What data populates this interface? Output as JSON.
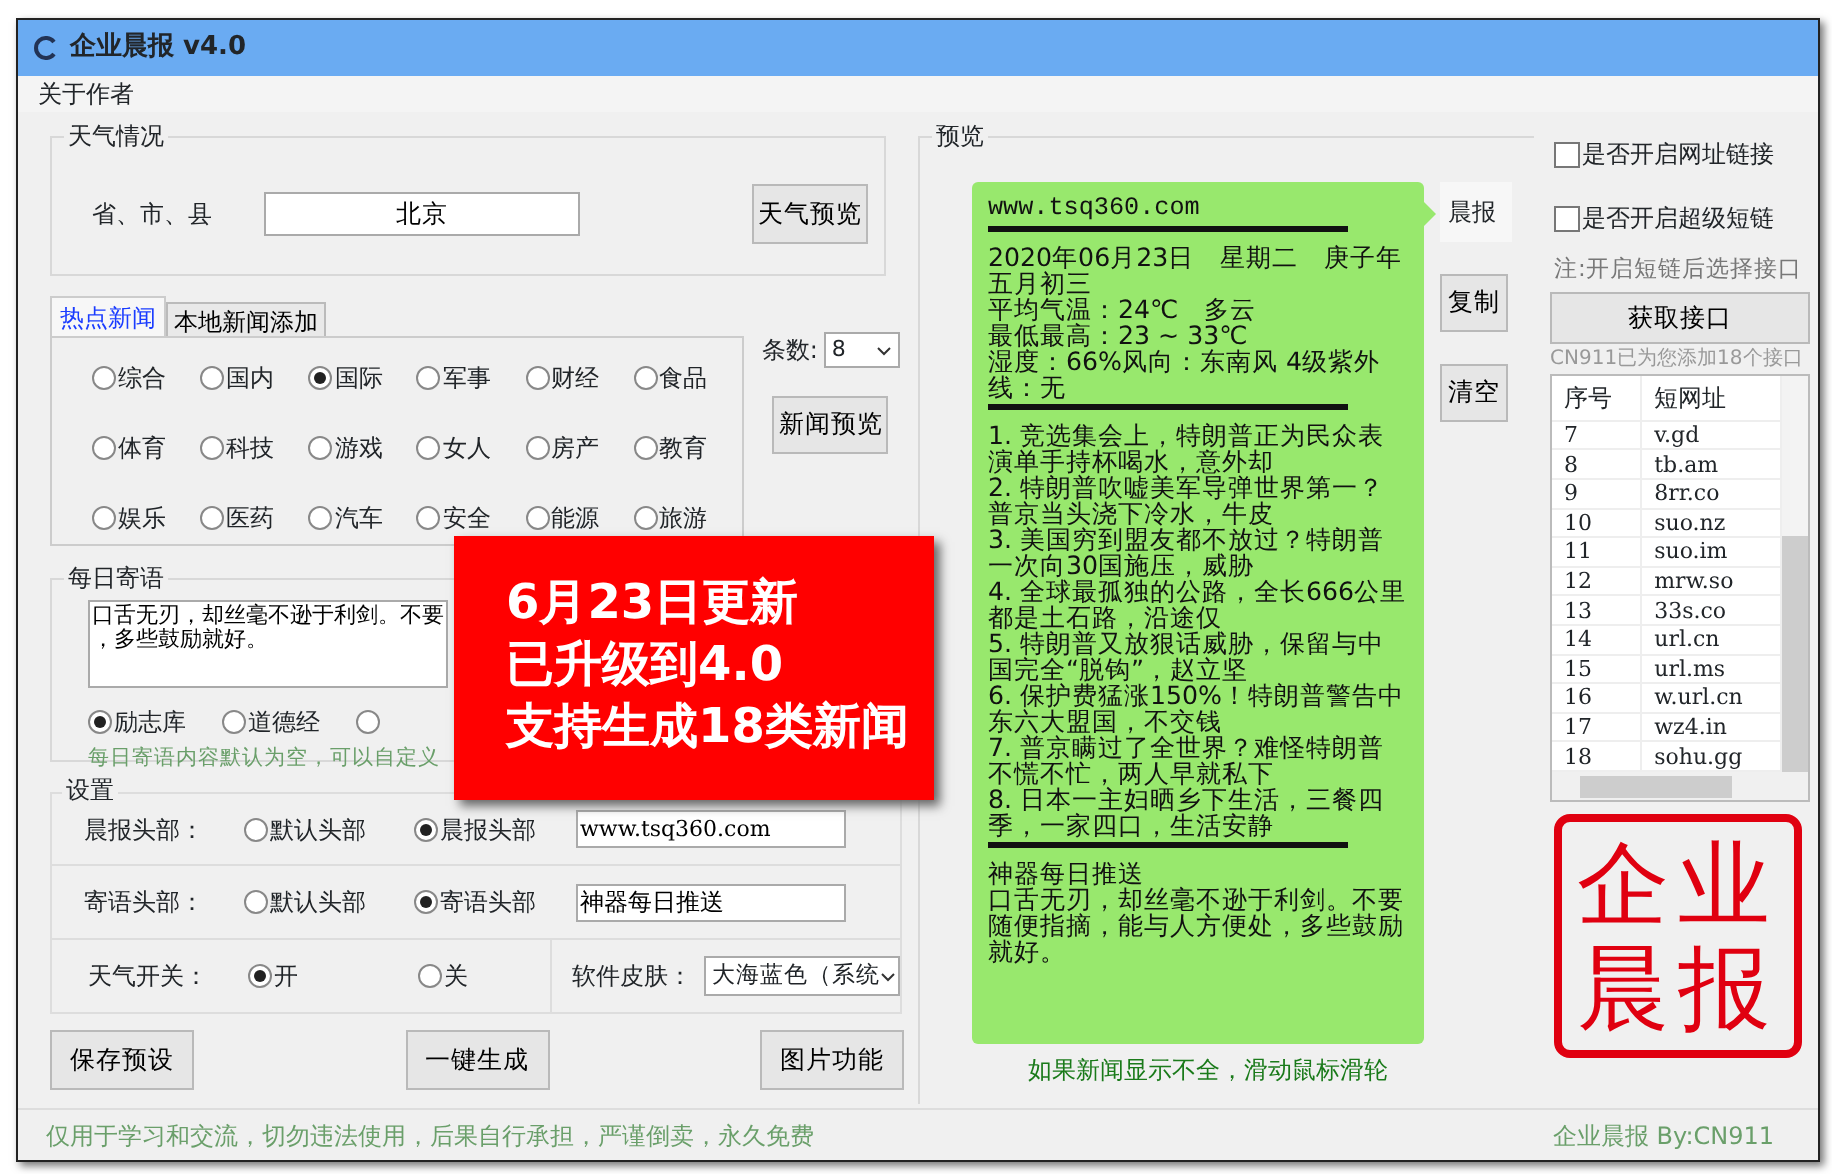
{
  "window": {
    "title": "企业晨报 v4.0"
  },
  "menu": [
    "关于作者"
  ],
  "weather": {
    "title": "天气情况",
    "label": "省、市、县",
    "value": "北京",
    "button": "天气预览"
  },
  "news": {
    "tabs": [
      {
        "label": "热点新闻",
        "selected": true
      },
      {
        "label": "本地新闻添加",
        "selected": false
      }
    ],
    "categories": [
      {
        "label": "综合",
        "selected": false
      },
      {
        "label": "国内",
        "selected": false
      },
      {
        "label": "国际",
        "selected": true
      },
      {
        "label": "军事",
        "selected": false
      },
      {
        "label": "财经",
        "selected": false
      },
      {
        "label": "食品",
        "selected": false
      },
      {
        "label": "体育",
        "selected": false
      },
      {
        "label": "科技",
        "selected": false
      },
      {
        "label": "游戏",
        "selected": false
      },
      {
        "label": "女人",
        "selected": false
      },
      {
        "label": "房产",
        "selected": false
      },
      {
        "label": "教育",
        "selected": false
      },
      {
        "label": "娱乐",
        "selected": false
      },
      {
        "label": "医药",
        "selected": false
      },
      {
        "label": "汽车",
        "selected": false
      },
      {
        "label": "安全",
        "selected": false
      },
      {
        "label": "能源",
        "selected": false
      },
      {
        "label": "旅游",
        "selected": false
      }
    ],
    "count_label": "条数:",
    "count": "8",
    "button": "新闻预览"
  },
  "daily": {
    "title": "每日寄语",
    "text": "口舌无刃，却丝毫不逊于利剑。不要，多些鼓励就好。",
    "sources": [
      {
        "label": "励志库",
        "selected": true
      },
      {
        "label": "道德经",
        "selected": false
      },
      {
        "selected": false
      }
    ],
    "hint": "每日寄语内容默认为空，可以自定义"
  },
  "settings": {
    "title": "设置",
    "rows": [
      {
        "label": "晨报头部：",
        "options": [
          {
            "label": "默认头部",
            "selected": false
          },
          {
            "label": "晨报头部",
            "selected": true
          }
        ],
        "value": "www.tsq360.com"
      },
      {
        "label": "寄语头部：",
        "options": [
          {
            "label": "默认头部",
            "selected": false
          },
          {
            "label": "寄语头部",
            "selected": true
          }
        ],
        "value": "神器每日推送"
      }
    ],
    "weather_switch": {
      "label": "天气开关：",
      "options": [
        {
          "label": "开",
          "selected": true
        },
        {
          "label": "关",
          "selected": false
        }
      ]
    },
    "skin": {
      "label": "软件皮肤：",
      "value": "大海蓝色（系统"
    }
  },
  "actions": [
    "保存预设",
    "一键生成",
    "图片功能"
  ],
  "preview": {
    "title": "预览",
    "header": "www.tsq360.com",
    "weather": [
      "2020年06月23日　星期二　庚子年五月初三",
      "平均气温：24℃　多云",
      "最低最高：23 ~ 33℃",
      "湿度：66%风向：东南风 4级紫外线：无"
    ],
    "news": [
      "1. 竞选集会上，特朗普正为民众表演单手持杯喝水，意外却",
      "2. 特朗普吹嘘美军导弹世界第一？普京当头浇下冷水，牛皮",
      "3. 美国穷到盟友都不放过？特朗普一次向30国施压，威胁",
      "4. 全球最孤独的公路，全长666公里都是土石路，沿途仅",
      "5. 特朗普又放狠话威胁，保留与中国完全“脱钩”，赵立坚",
      "6. 保护费猛涨150%！特朗普警告中东六大盟国，不交钱",
      "7. 普京瞒过了全世界？难怪特朗普不慌不忙，两人早就私下",
      "8. 日本一主妇晒乡下生活，三餐四季，一家四口，生活安静"
    ],
    "footer_title": "神器每日推送",
    "footer_text": "口舌无刃，却丝毫不逊于利剑。不要随便指摘，能与人方便处，多些鼓励就好。",
    "sender": "晨报",
    "buttons": [
      "复制",
      "清空"
    ],
    "hint": "如果新闻显示不全，滑动鼠标滑轮"
  },
  "links": {
    "options": [
      {
        "label": "是否开启网址链接",
        "checked": false
      },
      {
        "label": "是否开启超级短链",
        "checked": false
      }
    ],
    "note": "注:开启短链后选择接口",
    "button": "获取接口",
    "count_text": "CN911已为您添加18个接口",
    "table": {
      "columns": [
        "序号",
        "短网址"
      ],
      "rows": [
        [
          "7",
          "v.gd"
        ],
        [
          "8",
          "tb.am"
        ],
        [
          "9",
          "8rr.co"
        ],
        [
          "10",
          "suo.nz"
        ],
        [
          "11",
          "suo.im"
        ],
        [
          "12",
          "mrw.so"
        ],
        [
          "13",
          "33s.co"
        ],
        [
          "14",
          "url.cn"
        ],
        [
          "15",
          "url.ms"
        ],
        [
          "16",
          "w.url.cn"
        ],
        [
          "17",
          "wz4.in"
        ],
        [
          "18",
          "sohu.gg"
        ]
      ]
    }
  },
  "seal": {
    "text": "企业晨报"
  },
  "status_bar": {
    "notice": "仅用于学习和交流，切勿违法使用，后果自行承担，严谨倒卖，永久免费",
    "credit": "企业晨报 By:CN911"
  },
  "banner": {
    "lines": [
      "6月23日更新",
      "已升级到4.0",
      "支持生成18类新闻"
    ]
  }
}
